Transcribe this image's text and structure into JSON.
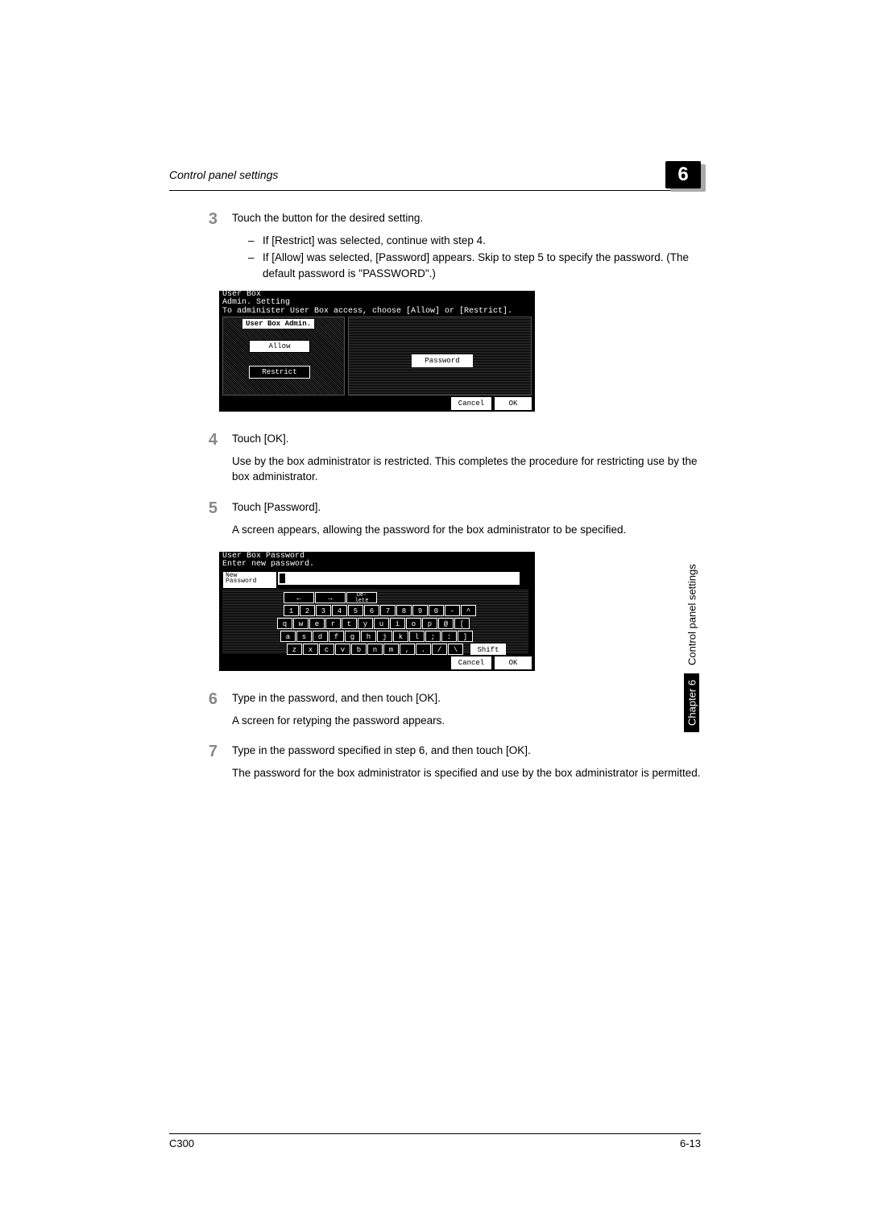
{
  "header": {
    "title": "Control panel settings",
    "chapter_number": "6"
  },
  "steps": {
    "s3": {
      "num": "3",
      "line1": "Touch the button for the desired setting.",
      "bullet1": "If [Restrict] was selected, continue with step 4.",
      "bullet2": "If [Allow] was selected, [Password] appears. Skip to step 5 to specify the password. (The default password is \"PASSWORD\".)"
    },
    "s4": {
      "num": "4",
      "line1": "Touch [OK].",
      "line2": "Use by the box administrator is restricted. This completes the procedure for restricting use by the box administrator."
    },
    "s5": {
      "num": "5",
      "line1": "Touch [Password].",
      "line2": "A screen appears, allowing the password for the box administrator to be specified."
    },
    "s6": {
      "num": "6",
      "line1": "Type in the password, and then touch [OK].",
      "line2": "A screen for retyping the password appears."
    },
    "s7": {
      "num": "7",
      "line1": "Type in the password specified in step 6, and then touch [OK].",
      "line2": "The password for the box administrator is specified and use by the box administrator is permitted."
    }
  },
  "screenshot1": {
    "title_line1": "User Box",
    "title_line2": "Admin. Setting",
    "subtitle": "To administer User Box access, choose [Allow] or [Restrict].",
    "left_header": "User Box Admin.",
    "btn_allow": "Allow",
    "btn_restrict": "Restrict",
    "btn_password": "Password",
    "btn_cancel": "Cancel",
    "btn_ok": "OK"
  },
  "screenshot2": {
    "title_line1": "User Box Password",
    "subtitle": "Enter new password.",
    "field_label_line1": "New",
    "field_label_line2": "Password",
    "cursor": "▮",
    "key_back": "←",
    "key_fwd": "→",
    "key_delete": "De-\nlete",
    "row_nums": [
      "1",
      "2",
      "3",
      "4",
      "5",
      "6",
      "7",
      "8",
      "9",
      "0",
      "-",
      "^"
    ],
    "row_q": [
      "q",
      "w",
      "e",
      "r",
      "t",
      "y",
      "u",
      "i",
      "o",
      "p",
      "@",
      "["
    ],
    "row_a": [
      "a",
      "s",
      "d",
      "f",
      "g",
      "h",
      "j",
      "k",
      "l",
      ";",
      ":",
      "]"
    ],
    "row_z": [
      "z",
      "x",
      "c",
      "v",
      "b",
      "n",
      "m",
      ",",
      ".",
      "/",
      "\\"
    ],
    "key_shift": "Shift",
    "btn_cancel": "Cancel",
    "btn_ok": "OK"
  },
  "side_tab": {
    "chapter": "Chapter 6",
    "label": "Control panel settings"
  },
  "footer": {
    "left": "C300",
    "right": "6-13"
  }
}
